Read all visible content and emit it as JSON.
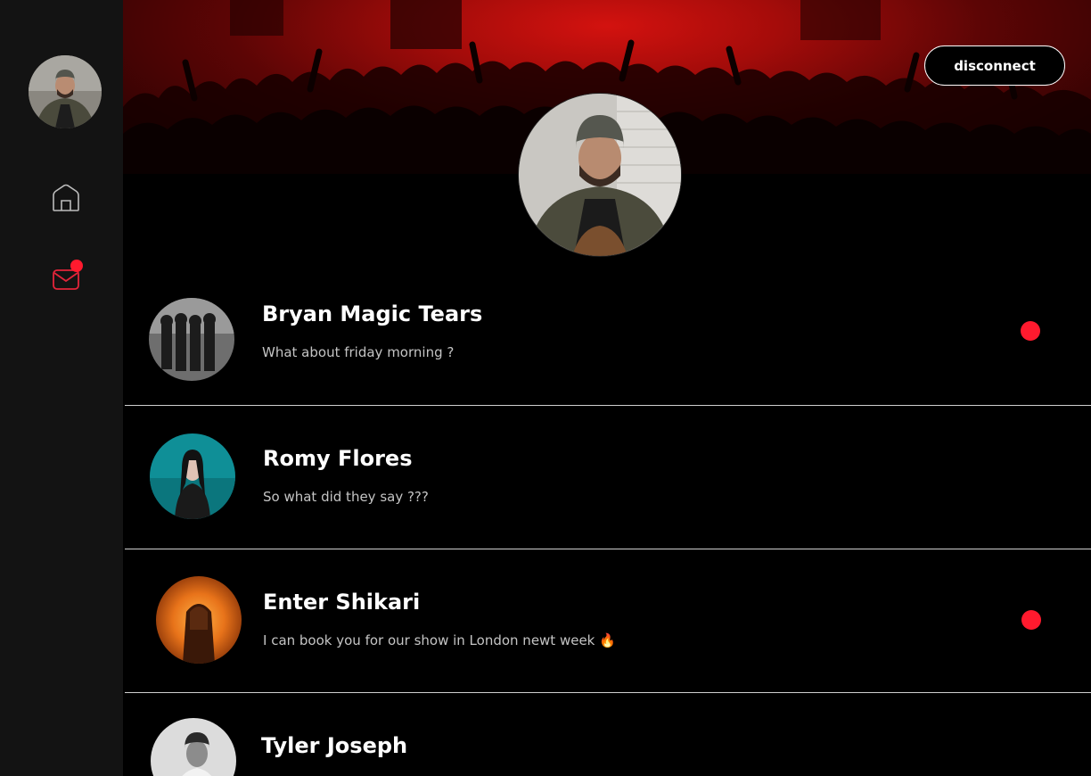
{
  "header": {
    "disconnect_label": "disconnect"
  },
  "sidebar": {
    "items": [
      {
        "icon": "home-icon",
        "active": false
      },
      {
        "icon": "mail-icon",
        "active": true,
        "has_notification": true
      }
    ]
  },
  "conversations": [
    {
      "name": "Bryan Magic Tears",
      "preview": "What about friday morning ?",
      "unread": true
    },
    {
      "name": "Romy Flores",
      "preview": "So what did they say ???",
      "unread": false
    },
    {
      "name": "Enter Shikari",
      "preview": "I  can book you for our show in London newt week 🔥",
      "unread": true
    },
    {
      "name": "Tyler Joseph",
      "preview": "",
      "unread": false
    }
  ],
  "colors": {
    "accent": "#ff1a2e",
    "sidebar_bg": "#131313",
    "background": "#000000",
    "divider": "#cfcfcf",
    "preview_text": "#c4c4c4"
  }
}
